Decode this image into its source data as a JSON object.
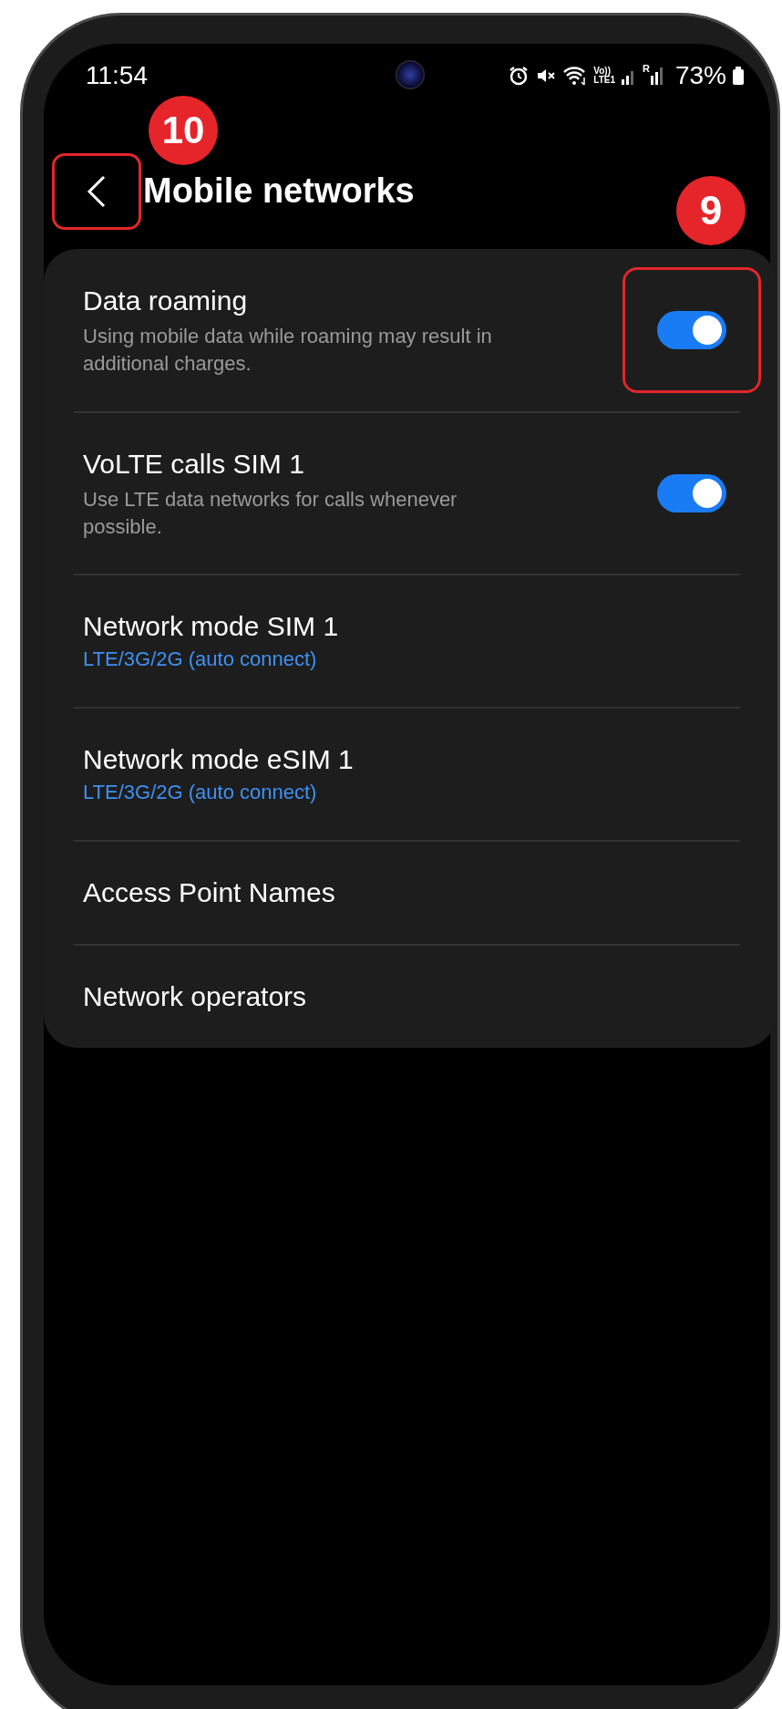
{
  "status_bar": {
    "time": "11:54",
    "volte_top": "Vo))",
    "volte_bottom": "LTE1",
    "roaming_mark": "R",
    "battery": "73%"
  },
  "header": {
    "title": "Mobile networks",
    "back_highlighted": true,
    "back_badge": "10"
  },
  "items": [
    {
      "kind": "toggle",
      "title": "Data roaming",
      "description": "Using mobile data while roaming may result in additional charges.",
      "on": true,
      "highlighted": true,
      "badge": "9"
    },
    {
      "kind": "toggle",
      "title": "VoLTE calls SIM 1",
      "description": "Use LTE data networks for calls whenever possible.",
      "on": true
    },
    {
      "kind": "link",
      "title": "Network mode SIM 1",
      "value": "LTE/3G/2G (auto connect)"
    },
    {
      "kind": "link",
      "title": "Network mode eSIM 1",
      "value": "LTE/3G/2G (auto connect)"
    },
    {
      "kind": "link",
      "title": "Access Point Names"
    },
    {
      "kind": "link",
      "title": "Network operators"
    }
  ]
}
